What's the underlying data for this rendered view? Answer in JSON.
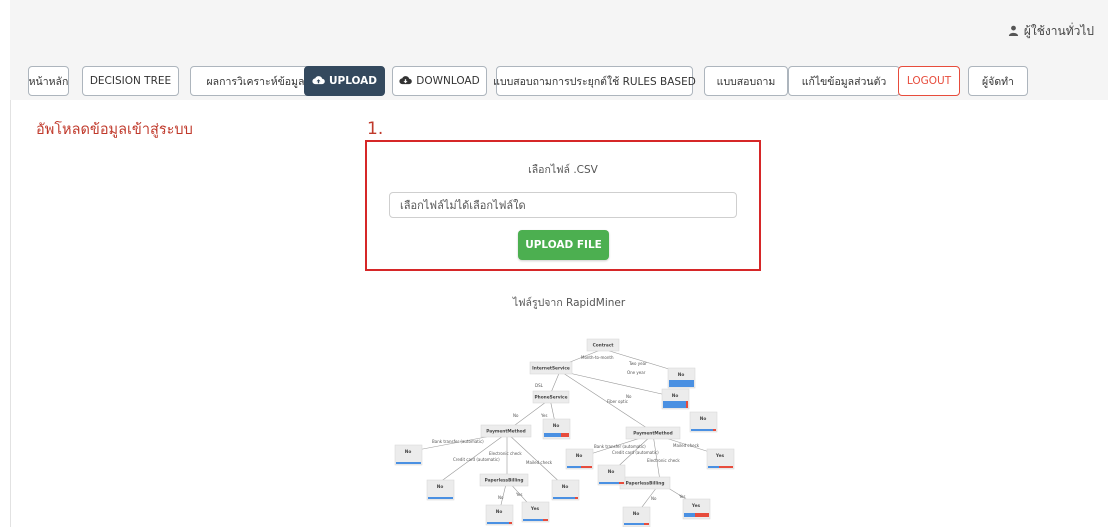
{
  "user": {
    "icon": "user-icon",
    "name": "ผู้ใช้งานทั่วไป"
  },
  "nav": [
    {
      "label": "หน้าหลัก",
      "name": "nav-home"
    },
    {
      "label": "DECISION TREE",
      "name": "nav-decision-tree"
    },
    {
      "label": "ผลการวิเคราะห์ข้อมูล",
      "name": "nav-analysis"
    },
    {
      "label": "UPLOAD",
      "name": "nav-upload",
      "icon": "cloud-upload-icon",
      "active": true
    },
    {
      "label": "DOWNLOAD",
      "name": "nav-download",
      "icon": "cloud-download-icon"
    },
    {
      "label": "แบบสอบถามการประยุกต์ใช้ RULES BASED",
      "name": "nav-rules-survey"
    },
    {
      "label": "แบบสอบถาม",
      "name": "nav-survey"
    },
    {
      "label": "แก้ไขข้อมูลส่วนตัว",
      "name": "nav-edit-profile"
    },
    {
      "label": "LOGOUT",
      "name": "nav-logout"
    },
    {
      "label": "ผู้จัดทำ",
      "name": "nav-authors"
    }
  ],
  "page_title": "อัพโหลดข้อมูลเข้าสู่ระบบ",
  "step_number": "1.",
  "upload": {
    "choose_label": "เลือกไฟล์ .CSV",
    "file_input_value": "เลือกไฟล์ไม่ได้เลือกไฟล์ใด",
    "button_label": "UPLOAD FILE"
  },
  "rapidminer_caption": "ไฟล์รูปจาก RapidMiner",
  "colors": {
    "accent_red": "#d62728",
    "nav_active": "#34495e",
    "upload_green": "#4caf50",
    "logout_red": "#e74c3c"
  }
}
